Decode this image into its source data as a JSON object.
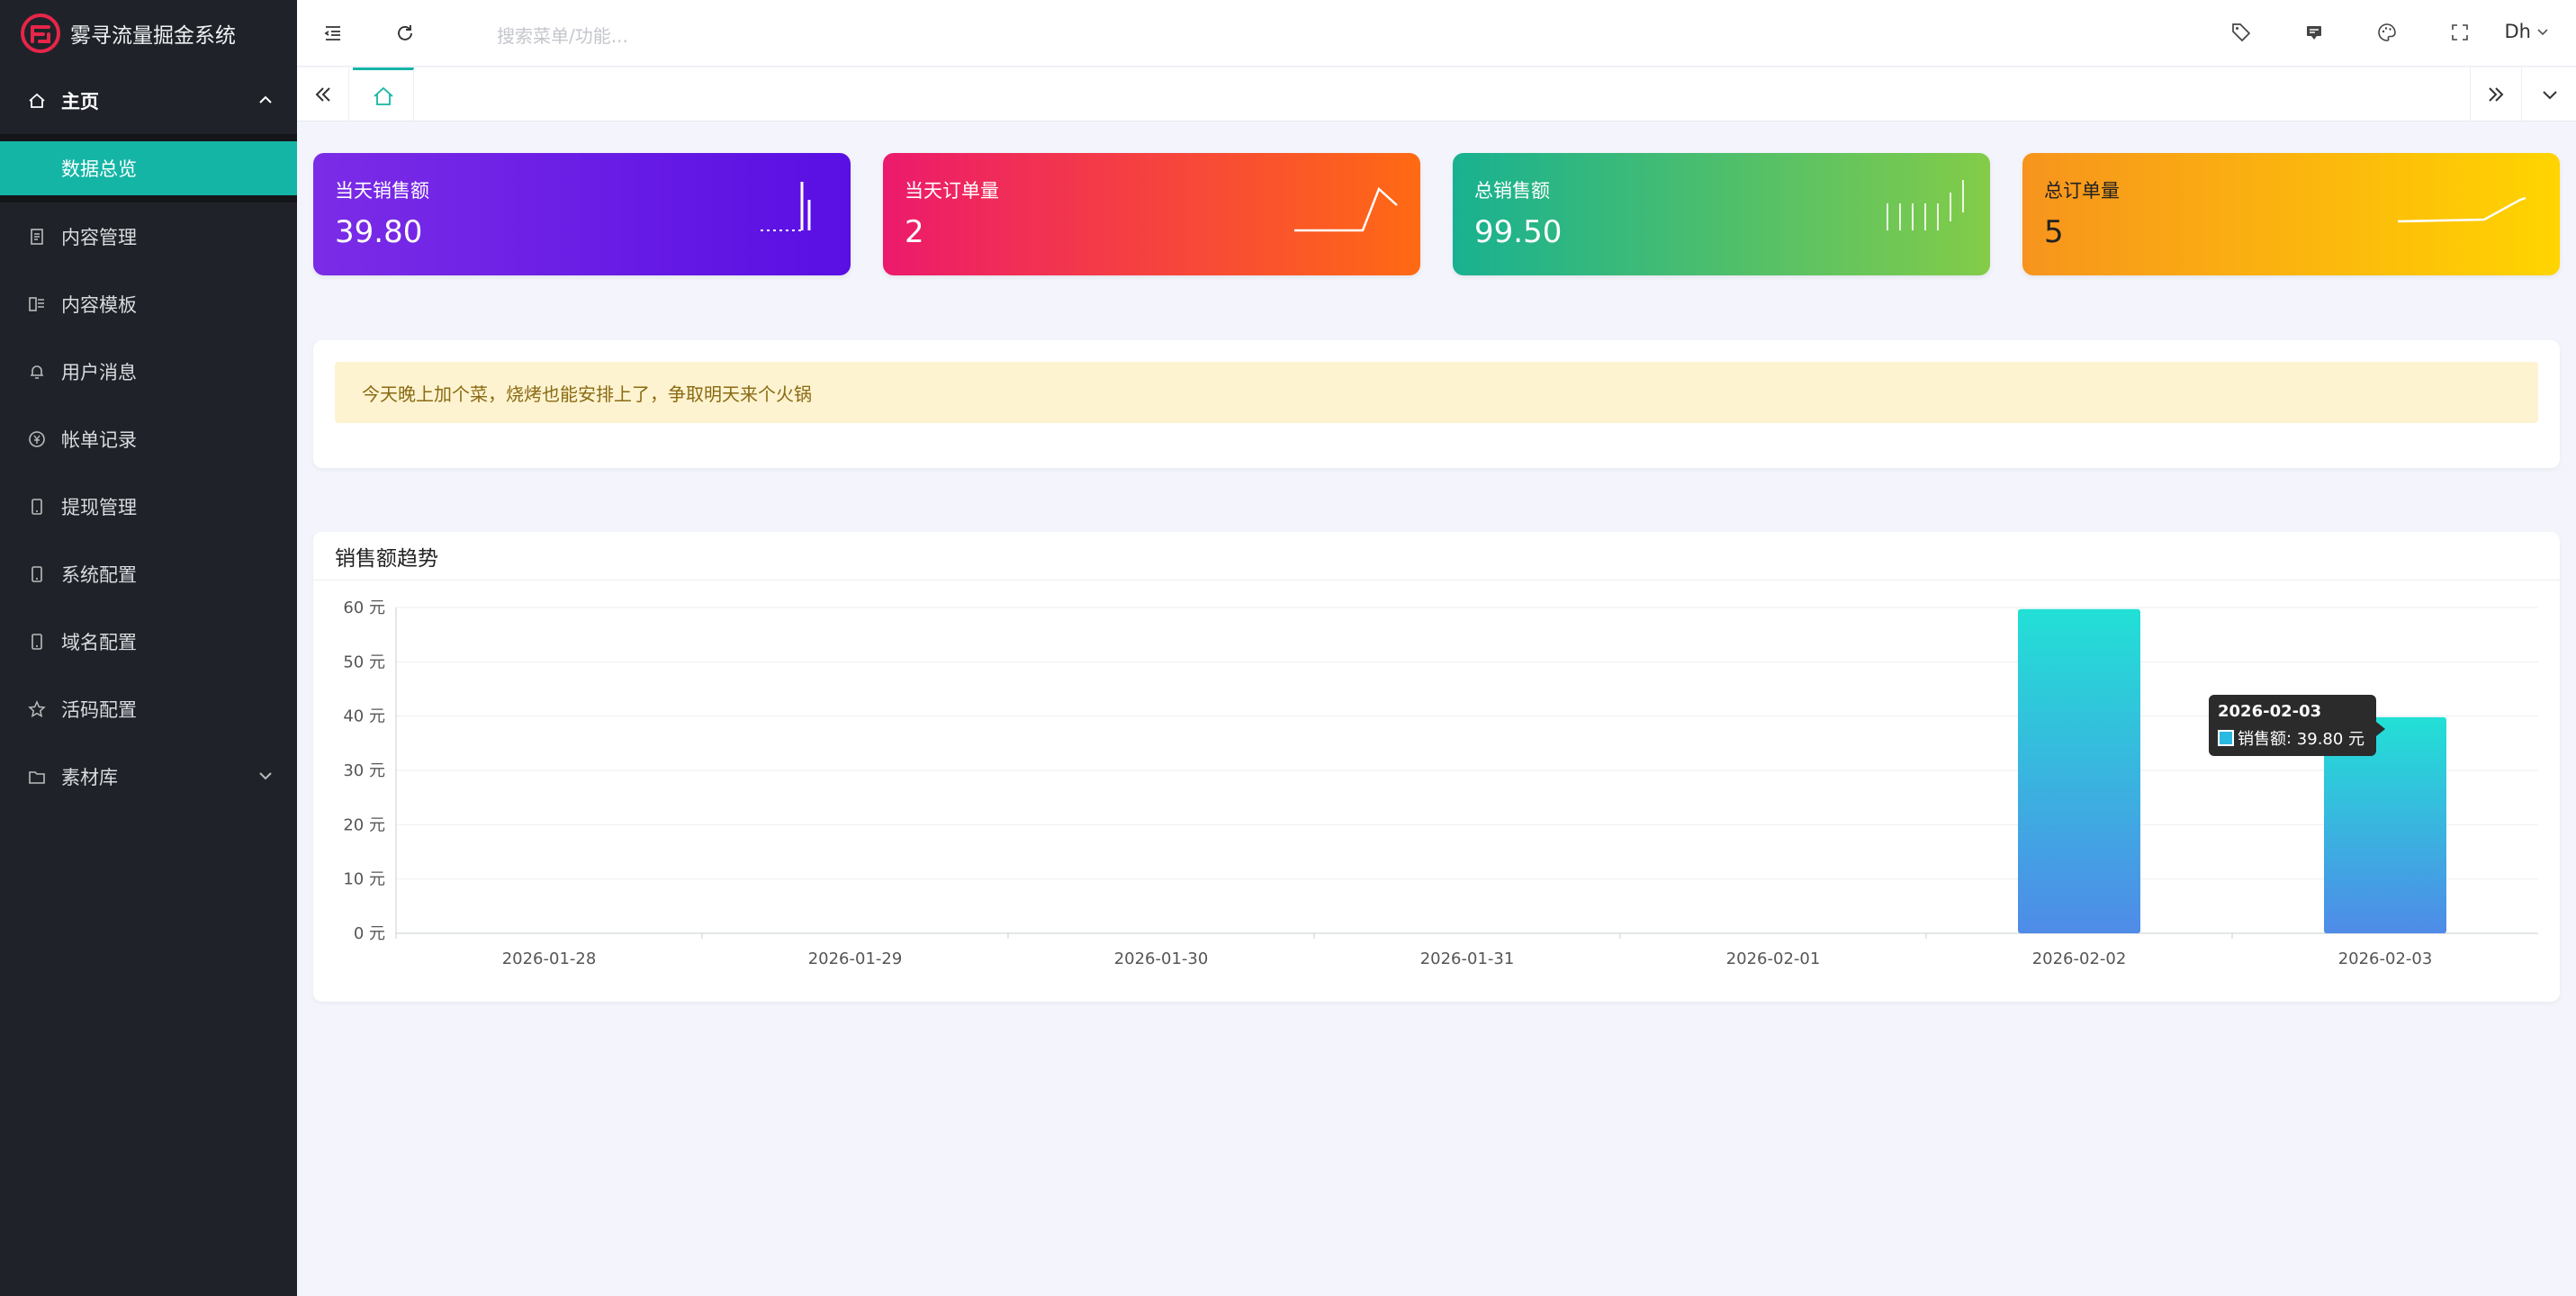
{
  "app": {
    "title": "雾寻流量掘金系统",
    "brand_color": "#e8254a",
    "accent": "#15b5a6"
  },
  "sidebar": {
    "parent": {
      "label": "主页",
      "icon": "home-icon",
      "expanded": true
    },
    "active_sub": "数据总览",
    "items": [
      {
        "label": "内容管理",
        "icon": "document-icon"
      },
      {
        "label": "内容模板",
        "icon": "template-icon"
      },
      {
        "label": "用户消息",
        "icon": "bell-icon"
      },
      {
        "label": "帐单记录",
        "icon": "yen-icon"
      },
      {
        "label": "提现管理",
        "icon": "phone-icon"
      },
      {
        "label": "系统配置",
        "icon": "phone-icon"
      },
      {
        "label": "域名配置",
        "icon": "phone-icon"
      },
      {
        "label": "活码配置",
        "icon": "star-icon"
      },
      {
        "label": "素材库",
        "icon": "folder-icon"
      }
    ]
  },
  "header": {
    "search_placeholder": "搜索菜单/功能...",
    "user": "Dh"
  },
  "cards": [
    {
      "title": "当天销售额",
      "value": "39.80"
    },
    {
      "title": "当天订单量",
      "value": "2"
    },
    {
      "title": "总销售额",
      "value": "99.50"
    },
    {
      "title": "总订单量",
      "value": "5"
    }
  ],
  "notice": "今天晚上加个菜，烧烤也能安排上了，争取明天来个火锅",
  "chart_panel": {
    "title": "销售额趋势"
  },
  "chart_data": {
    "type": "bar",
    "title": "销售额趋势",
    "categories": [
      "2026-01-28",
      "2026-01-29",
      "2026-01-30",
      "2026-01-31",
      "2026-02-01",
      "2026-02-02",
      "2026-02-03"
    ],
    "series": [
      {
        "name": "销售额",
        "values": [
          0,
          0,
          0,
          0,
          0,
          59.7,
          39.8
        ]
      }
    ],
    "ylim": [
      0,
      60
    ],
    "yticks": [
      0,
      10,
      20,
      30,
      40,
      50,
      60
    ],
    "y_unit": "元",
    "grid": true,
    "bar_gradient": [
      "#22e0d6",
      "#4f8be8"
    ]
  },
  "tooltip": {
    "date": "2026-02-03",
    "series_label": "销售额",
    "value_text": "39.80 元"
  }
}
